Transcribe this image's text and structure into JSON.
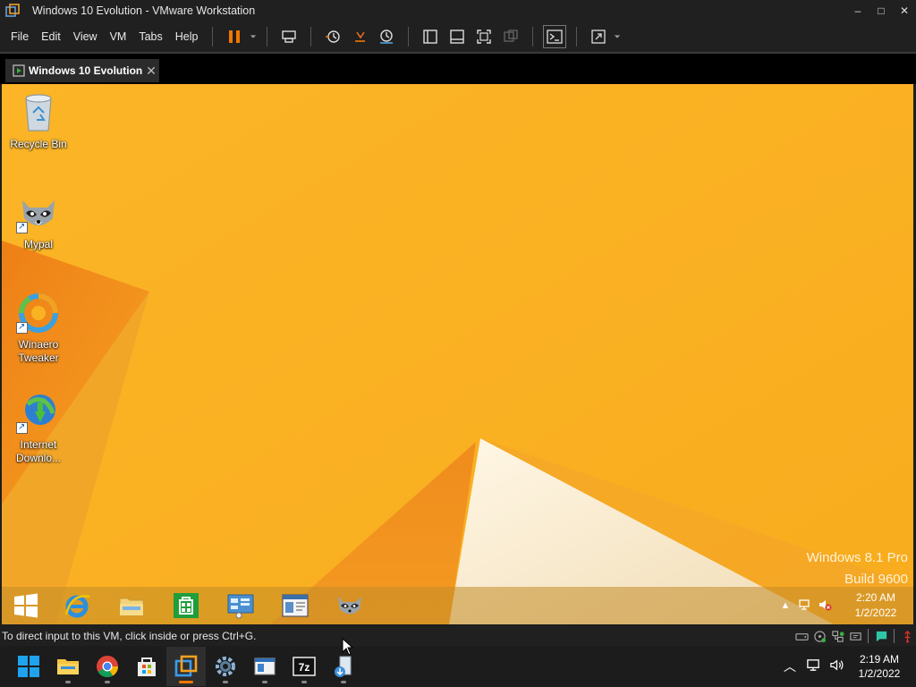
{
  "window": {
    "title": "Windows 10 Evolution - VMware Workstation",
    "controls": {
      "minimize": "–",
      "maximize": "□",
      "close": "✕"
    }
  },
  "menu": {
    "items": [
      "File",
      "Edit",
      "View",
      "VM",
      "Tabs",
      "Help"
    ]
  },
  "toolbar": {
    "icons": [
      "pause-icon",
      "send-ctrl-alt-del-icon",
      "snapshot-icon",
      "revert-snapshot-icon",
      "snapshot-manager-icon",
      "library-view-icon",
      "thumbnail-bar-icon",
      "full-screen-icon",
      "unity-icon",
      "console-view-icon",
      "stretch-guest-icon"
    ]
  },
  "tab": {
    "label": "Windows 10 Evolution",
    "close": "✕"
  },
  "guest": {
    "desktop_icons": [
      {
        "label": "Recycle Bin",
        "icon": "recycle-bin-icon"
      },
      {
        "label": "Mypal",
        "icon": "mypal-raccoon-icon"
      },
      {
        "label": "Winaero Tweaker",
        "icon": "winaero-tweaker-icon"
      },
      {
        "label": "Internet Downlo...",
        "icon": "internet-download-manager-icon"
      }
    ],
    "watermark": {
      "line1": "Windows 8.1 Pro",
      "line2": "Build 9600"
    },
    "taskbar": {
      "items": [
        "windows-start-icon",
        "internet-explorer-icon",
        "file-explorer-icon",
        "store-icon",
        "control-panel-icon",
        "window-app-icon",
        "mypal-raccoon-icon"
      ],
      "tray": {
        "chevron": "▲",
        "time": "2:20 AM",
        "date": "1/2/2022"
      }
    },
    "colors": {
      "wallpaper": "#f9b322",
      "wallpaper_dark": "#e8861a"
    }
  },
  "statusbar": {
    "text": "To direct input to this VM, click inside or press Ctrl+G."
  },
  "host_taskbar": {
    "items": [
      "windows-11-start-icon",
      "file-explorer-icon",
      "chrome-icon",
      "store-icon",
      "vmware-workstation-icon",
      "settings-icon",
      "window-app-icon",
      "7zip-icon",
      "app-installer-icon"
    ],
    "active_item": "vmware-workstation-icon",
    "tray": {
      "chevron": "︿",
      "time": "2:19 AM",
      "date": "1/2/2022"
    }
  }
}
